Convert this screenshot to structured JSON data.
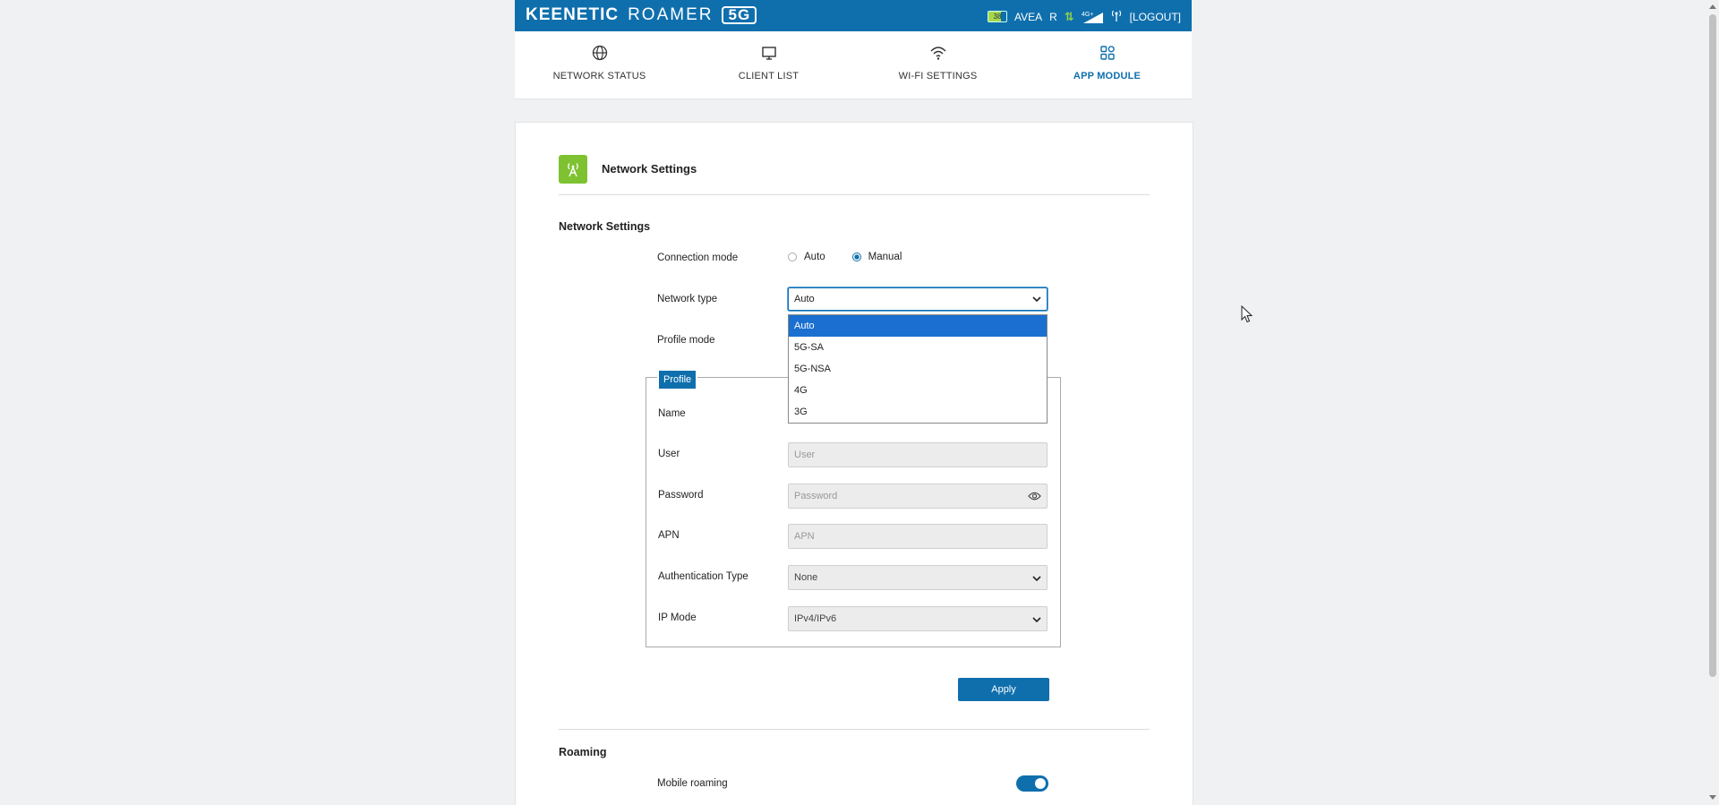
{
  "header": {
    "brand_keenetic": "KEENETIC",
    "brand_roamer": "ROAMER",
    "brand_5g": "5G",
    "battery_level": "38",
    "operator": "AVEA",
    "roaming_indicator": "R",
    "network_gen": "4G+",
    "logout_label": "[LOGOUT]"
  },
  "nav": {
    "items": [
      {
        "label": "NETWORK STATUS",
        "icon": "globe-icon"
      },
      {
        "label": "CLIENT LIST",
        "icon": "monitor-icon"
      },
      {
        "label": "WI-FI SETTINGS",
        "icon": "wifi-icon"
      },
      {
        "label": "APP MODULE",
        "icon": "apps-grid-icon",
        "active": true
      }
    ]
  },
  "module": {
    "title": "Network Settings",
    "icon": "antenna-tower-icon"
  },
  "network_settings": {
    "section_title": "Network Settings",
    "connection_mode_label": "Connection mode",
    "connection_mode_options": [
      "Auto",
      "Manual"
    ],
    "connection_mode_selected": "Manual",
    "network_type_label": "Network type",
    "network_type_value": "Auto",
    "network_type_options": [
      "Auto",
      "5G-SA",
      "5G-NSA",
      "4G",
      "3G"
    ],
    "profile_mode_label": "Profile mode"
  },
  "profile": {
    "legend": "Profile",
    "name_label": "Name",
    "user_label": "User",
    "user_placeholder": "User",
    "password_label": "Password",
    "password_placeholder": "Password",
    "apn_label": "APN",
    "apn_placeholder": "APN",
    "auth_type_label": "Authentication Type",
    "auth_type_value": "None",
    "ip_mode_label": "IP Mode",
    "ip_mode_value": "IPv4/IPv6"
  },
  "apply_label": "Apply",
  "roaming": {
    "section_title": "Roaming",
    "mobile_roaming_label": "Mobile roaming",
    "mobile_roaming_enabled": true
  },
  "colors": {
    "primary": "#0f6fad",
    "module_icon_bg": "#7ec231",
    "dropdown_selected": "#1a6fd0"
  }
}
